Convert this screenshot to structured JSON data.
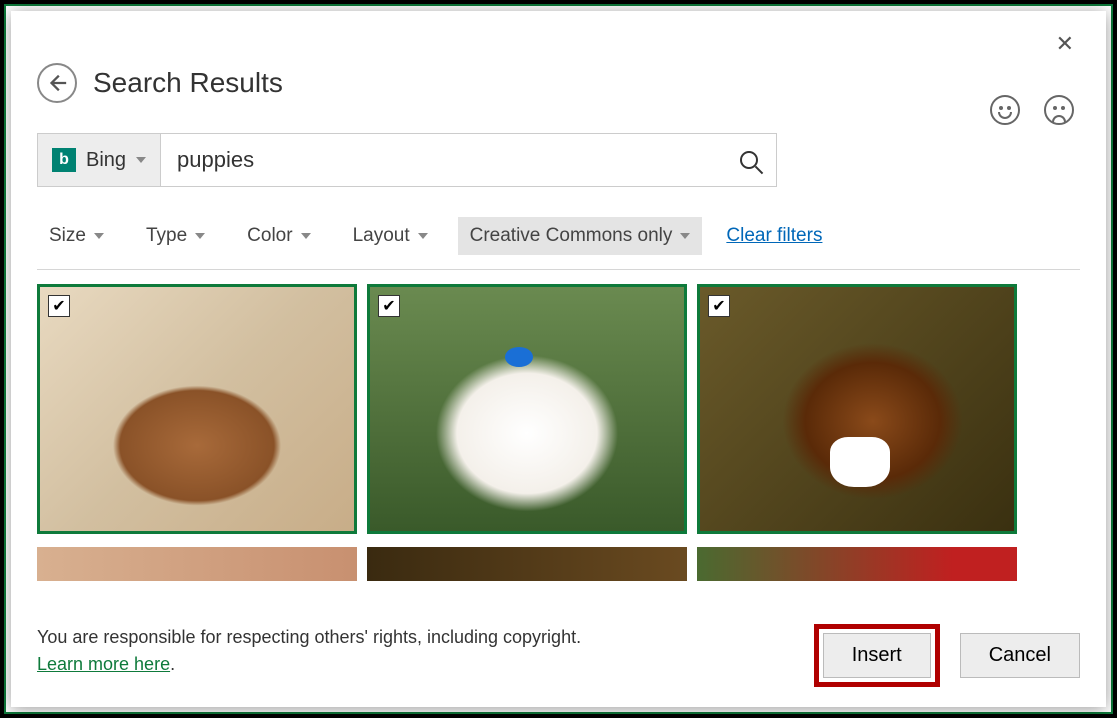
{
  "dialog": {
    "title": "Search Results",
    "provider": "Bing",
    "search_value": "puppies",
    "filters": {
      "size": "Size",
      "type": "Type",
      "color": "Color",
      "layout": "Layout",
      "cc": "Creative Commons only",
      "clear": "Clear filters"
    },
    "results": [
      {
        "checked": true,
        "alt": "brown puppy on sand"
      },
      {
        "checked": true,
        "alt": "white fluffy puppy with blue bow"
      },
      {
        "checked": true,
        "alt": "beagle puppy on hay"
      }
    ],
    "disclaimer": "You are responsible for respecting others' rights, including copyright.",
    "learn_more": "Learn more here",
    "insert_label": "Insert",
    "cancel_label": "Cancel"
  }
}
